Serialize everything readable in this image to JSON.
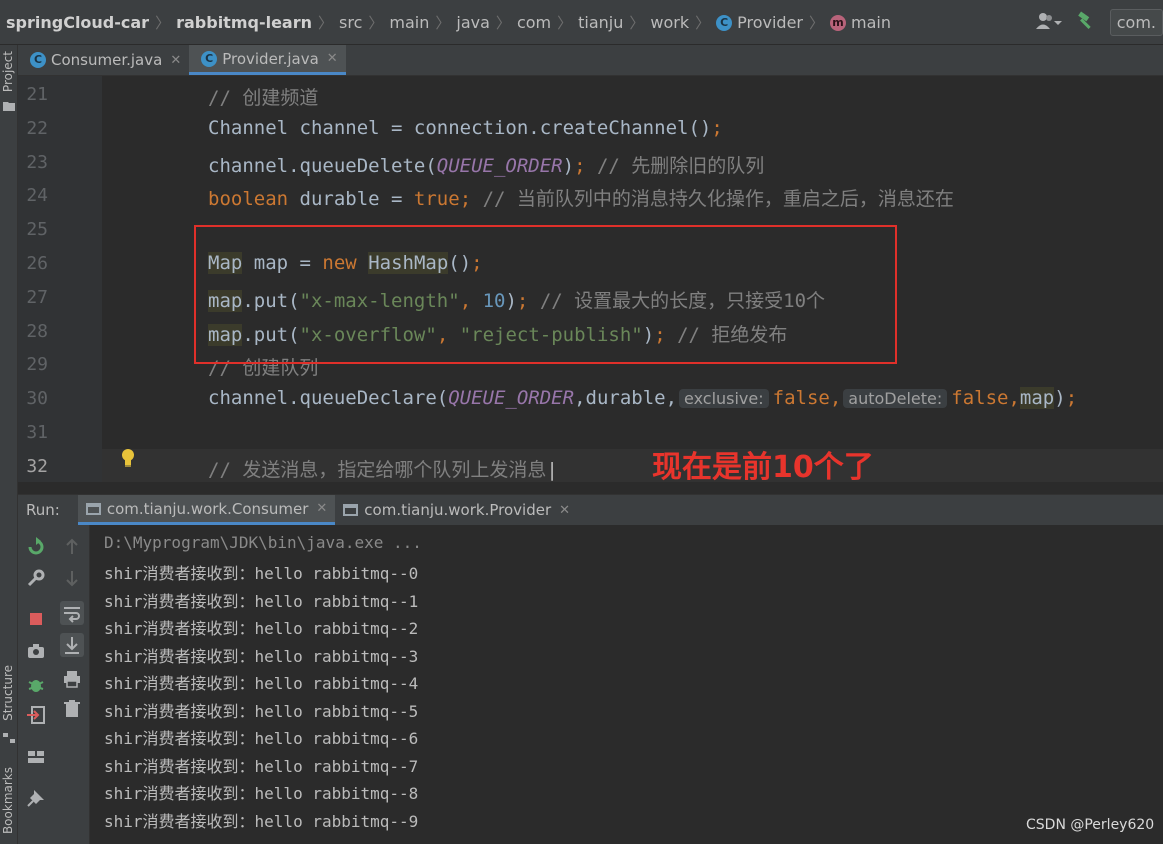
{
  "breadcrumb": {
    "items": [
      "springCloud-car",
      "rabbitmq-learn",
      "src",
      "main",
      "java",
      "com",
      "tianju",
      "work",
      "Provider",
      "main"
    ],
    "separator": "〉"
  },
  "toolbar": {
    "run_config": "com."
  },
  "left_stripe": {
    "project": "Project",
    "structure": "Structure",
    "bookmarks": "Bookmarks"
  },
  "editor_tabs": [
    {
      "label": "Consumer.java",
      "active": false
    },
    {
      "label": "Provider.java",
      "active": true
    }
  ],
  "editor": {
    "line_numbers": [
      "21",
      "22",
      "23",
      "24",
      "25",
      "26",
      "27",
      "28",
      "29",
      "30",
      "31",
      "32"
    ],
    "current_line": "32",
    "lines": {
      "l21": {
        "comment": "// 创建频道"
      },
      "l22": {
        "type": "Channel",
        "var": " channel = connection.createChannel()",
        "semi": ";"
      },
      "l23": {
        "a": "channel.queueDelete(",
        "field": "QUEUE_ORDER",
        "b": ")",
        "semi": ";",
        "comment": " // 先删除旧的队列"
      },
      "l24": {
        "kw": "boolean",
        "var": " durable = ",
        "val": "true",
        "semi": ";",
        "comment": " // 当前队列中的消息持久化操作，重启之后，消息还在"
      },
      "l26": {
        "type": "Map",
        "var": " map = ",
        "kw": "new",
        "sp": " ",
        "cls": "HashMap",
        "rest": "()",
        "semi": ";"
      },
      "l27": {
        "obj": "map",
        "call": ".put(",
        "str": "\"x-max-length\"",
        "comma": ", ",
        "num": "10",
        "close": ")",
        "semi": ";",
        "comment": " // 设置最大的长度，只接受10个"
      },
      "l28": {
        "obj": "map",
        "call": ".put(",
        "str1": "\"x-overflow\"",
        "comma": ", ",
        "str2": "\"reject-publish\"",
        "close": ")",
        "semi": ";",
        "comment": " // 拒绝发布"
      },
      "l29": {
        "comment": "// 创建队列"
      },
      "l30": {
        "a": "channel.queueDeclare(",
        "field": "QUEUE_ORDER",
        "b": ",durable,",
        "hint1": "exclusive:",
        "v1": "false",
        "c1": ",",
        "hint2": "autoDelete:",
        "v2": "false",
        "c2": ",",
        "arg": "map",
        "end": ")",
        "semi": ";"
      },
      "l32": {
        "comment": "// 发送消息，指定给哪个队列上发消息"
      }
    }
  },
  "annotation": "现在是前10个了",
  "run_panel": {
    "label": "Run:",
    "tabs": [
      {
        "label": "com.tianju.work.Consumer",
        "active": true
      },
      {
        "label": "com.tianju.work.Provider",
        "active": false
      }
    ],
    "console": {
      "command": "D:\\Myprogram\\JDK\\bin\\java.exe ...",
      "lines": [
        "shir消费者接收到：hello rabbitmq--0",
        "shir消费者接收到：hello rabbitmq--1",
        "shir消费者接收到：hello rabbitmq--2",
        "shir消费者接收到：hello rabbitmq--3",
        "shir消费者接收到：hello rabbitmq--4",
        "shir消费者接收到：hello rabbitmq--5",
        "shir消费者接收到：hello rabbitmq--6",
        "shir消费者接收到：hello rabbitmq--7",
        "shir消费者接收到：hello rabbitmq--8",
        "shir消费者接收到：hello rabbitmq--9"
      ]
    }
  },
  "watermark": "CSDN @Perley620",
  "colors": {
    "keyword": "#CC7832",
    "string": "#6A8759",
    "number": "#6897BB",
    "field": "#9876AA",
    "comment": "#808080",
    "annotation_red": "#E0302A",
    "accent": "#4A88C7"
  }
}
